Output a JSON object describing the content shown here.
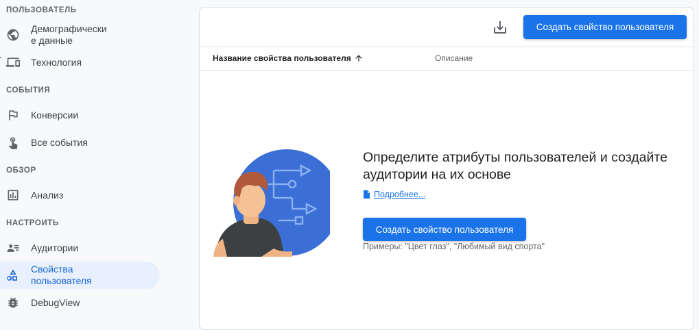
{
  "sidebar": {
    "sections": {
      "user": "ПОЛЬЗОВАТЕЛЬ",
      "events": "СОБЫТИЯ",
      "explore": "ОБЗОР",
      "configure": "НАСТРОИТЬ"
    },
    "items": {
      "demographics": {
        "line1": "Демографически",
        "line2": "е данные",
        "icon": "globe-icon"
      },
      "tech": {
        "label": "Технология",
        "icon": "devices-icon"
      },
      "conversions": {
        "label": "Конверсии",
        "icon": "flag-icon"
      },
      "all_events": {
        "label": "Все события",
        "icon": "touch-icon"
      },
      "analysis": {
        "label": "Анализ",
        "icon": "analysis-icon"
      },
      "audiences": {
        "label": "Аудитории",
        "icon": "audience-icon"
      },
      "user_props": {
        "line1": "Свойства",
        "line2": "пользователя",
        "icon": "shapes-icon",
        "active": true
      },
      "debugview": {
        "label": "DebugView",
        "icon": "bug-icon"
      }
    }
  },
  "toolbar": {
    "download_icon": "download-icon",
    "create_label": "Создать свойство пользователя"
  },
  "table": {
    "columns": {
      "name": "Название свойства пользователя",
      "description": "Описание"
    },
    "sort_icon": "arrow-up-icon"
  },
  "empty_state": {
    "title_line1": "Определите атрибуты пользователей и создайте",
    "title_line2": "аудитории на их основе",
    "learn_more": "Подробнее...",
    "create_label": "Создать свойство пользователя",
    "examples": "Примеры: \"Цвет глаз\", \"Любимый вид спорта\""
  },
  "colors": {
    "accent": "#1a73e8",
    "active_bg": "#e8f0fe",
    "active_text": "#1967d2"
  }
}
